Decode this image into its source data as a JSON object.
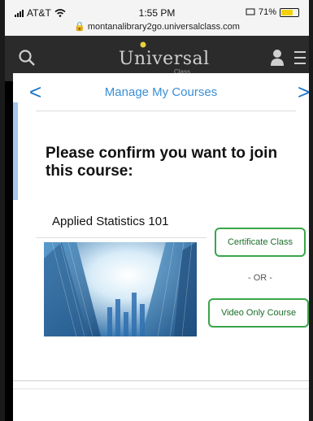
{
  "status_bar": {
    "carrier": "AT&T",
    "time": "1:55 PM",
    "battery": "71%",
    "battery_level": 0.71,
    "url": "montanalibrary2go.universalclass.com"
  },
  "header": {
    "logo_text": "Universal",
    "logo_sub": "Class",
    "icons": [
      "search-icon",
      "user-icon",
      "menu-icon"
    ]
  },
  "nav": {
    "title": "Manage My Courses",
    "prev": "<",
    "next": ">"
  },
  "confirm": {
    "heading": "Please confirm you want to join this course:"
  },
  "course": {
    "title": "Applied Statistics 101",
    "certificate_label": "Certificate Class",
    "or_label": "- OR -",
    "video_label": "Video Only Course"
  },
  "colors": {
    "accent_blue": "#3a8fd6",
    "button_green": "#3aa64a",
    "header_bg": "#2b2b2b"
  }
}
